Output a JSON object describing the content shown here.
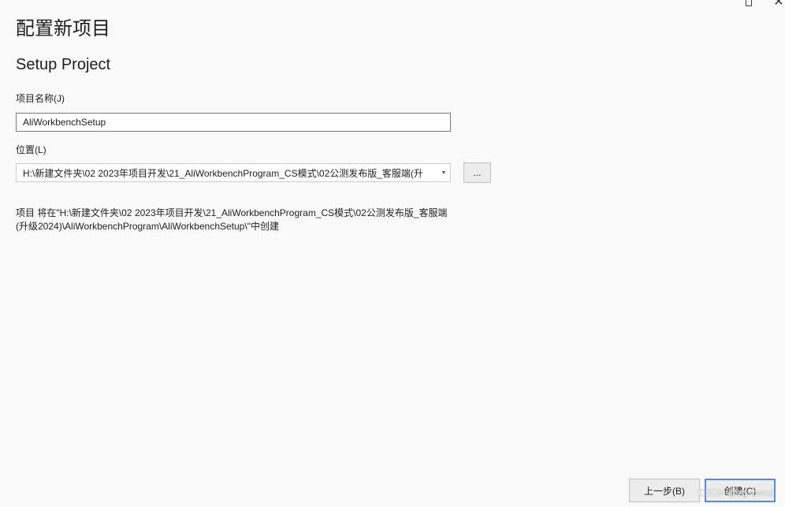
{
  "window": {
    "title": "配置新项目",
    "close_glyph": "✕"
  },
  "template": {
    "name": "Setup Project"
  },
  "project_name": {
    "label": "项目名称(J)",
    "value": "AliWorkbenchSetup"
  },
  "location": {
    "label": "位置(L)",
    "value": "H:\\新建文件夹\\02 2023年项目开发\\21_AliWorkbenchProgram_CS模式\\02公测发布版_客服端(升",
    "browse_label": "...",
    "dropdown_arrow": "▼"
  },
  "info": {
    "text": "项目 将在\"H:\\新建文件夹\\02 2023年项目开发\\21_AliWorkbenchProgram_CS模式\\02公测发布版_客服端(升级2024)\\AliWorkbenchProgram\\AliWorkbenchSetup\\\"中创建"
  },
  "footer": {
    "back_label": "上一步(B)",
    "create_label": "创建(C)"
  },
  "watermark": {
    "text": "CSDN @zgscwxd"
  },
  "colors": {
    "background": "#f9f9f9",
    "focus_border": "#5d8ad3"
  },
  "icons": {
    "maximize": "maximize-icon",
    "close": "close-icon",
    "dropdown": "chevron-down-icon"
  }
}
